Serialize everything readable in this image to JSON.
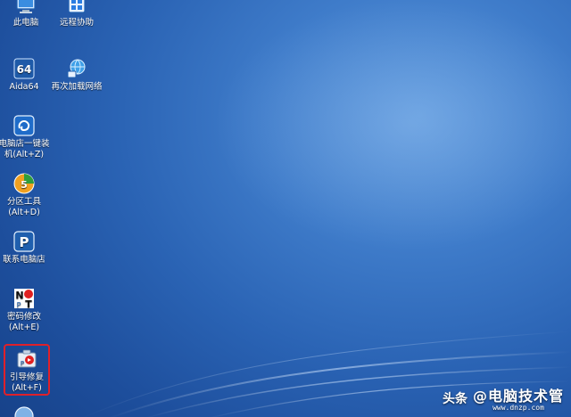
{
  "desktop": {
    "icons": [
      {
        "id": "this-pc",
        "label": "此电脑",
        "icon": "computer-icon",
        "selected": false
      },
      {
        "id": "remote-assist",
        "label": "远程协助",
        "icon": "remote-assist-icon",
        "selected": false
      },
      {
        "id": "aida64",
        "label": "Aida64",
        "icon": "aida64-icon",
        "selected": false
      },
      {
        "id": "reload-network",
        "label": "再次加载网络",
        "icon": "network-globe-icon",
        "selected": false
      },
      {
        "id": "one-click-install",
        "label_line1": "电脑店一键装",
        "label_line2": "机(Alt+Z)",
        "icon": "install-tool-icon",
        "selected": false
      },
      {
        "id": "partition-tool",
        "label_line1": "分区工具",
        "label_line2": "(Alt+D)",
        "icon": "partition-tool-icon",
        "selected": false
      },
      {
        "id": "contact-store",
        "label": "联系电脑店",
        "icon": "contact-store-icon",
        "selected": false
      },
      {
        "id": "password-change",
        "label_line1": "密码修改",
        "label_line2": "(Alt+E)",
        "icon": "password-tool-icon",
        "selected": false
      },
      {
        "id": "boot-repair",
        "label_line1": "引导修复",
        "label_line2": "(Alt+F)",
        "icon": "boot-repair-icon",
        "selected": true
      },
      {
        "id": "partial-icon",
        "label": "",
        "icon": "globe-icon",
        "selected": false
      }
    ],
    "selection_color": "#e0202a",
    "background_accent": "#3f7cca"
  },
  "watermark": {
    "source": "头条",
    "handle": "@电脑技术管",
    "domain": "www.dnzp.com"
  }
}
